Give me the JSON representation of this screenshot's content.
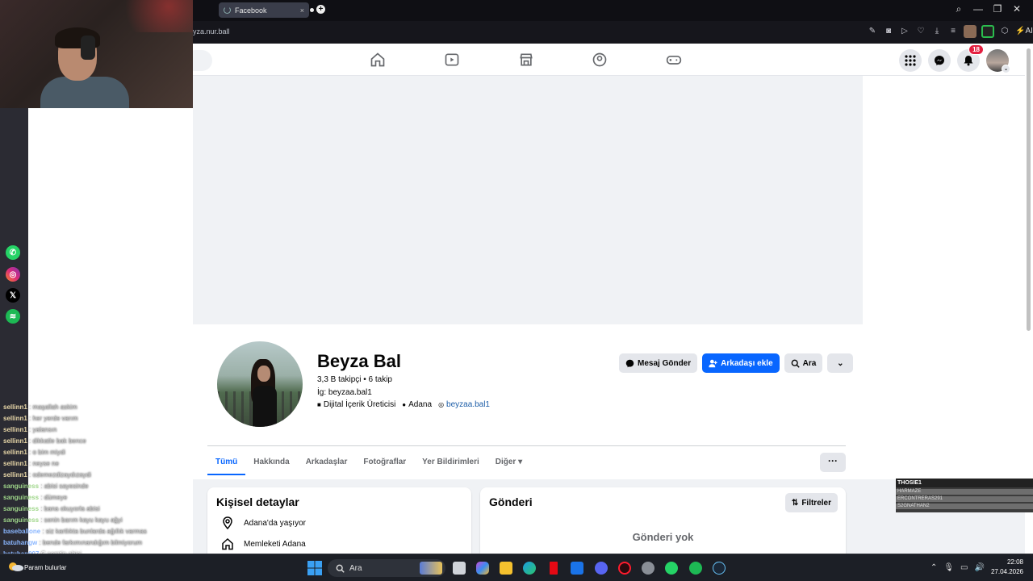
{
  "browser": {
    "tab_title": "Facebook",
    "tab_close": "×",
    "new_tab": "+",
    "address": "yza.nur.ball",
    "ai_label": "AI",
    "window_controls": [
      "⌕",
      "—",
      "❐",
      "✕"
    ]
  },
  "facebook": {
    "notification_count": "18",
    "profile": {
      "name": "Beyza Bal",
      "stats": "3,3 B takipçi • 6 takip",
      "instagram_line": "İg: beyzaa.bal1",
      "category": "Dijital İçerik Üreticisi",
      "location": "Adana",
      "link": "beyzaa.bal1"
    },
    "actions": {
      "message": "Mesaj Gönder",
      "add_friend": "Arkadaşı ekle",
      "search": "Ara"
    },
    "tabs": [
      "Tümü",
      "Hakkında",
      "Arkadaşlar",
      "Fotoğraflar",
      "Yer Bildirimleri",
      "Diğer"
    ],
    "details": {
      "title": "Kişisel detaylar",
      "lives": "Adana'da yaşıyor",
      "hometown": "Memleketi Adana"
    },
    "posts": {
      "title": "Gönderi",
      "filters": "Filtreler",
      "empty": "Gönderi yok"
    }
  },
  "chat": [
    {
      "user": "sellinn1",
      "msg": ": maşallah askim",
      "color": "u1"
    },
    {
      "user": "sellinn1",
      "msg": ": her yerde varım",
      "color": "u1"
    },
    {
      "user": "sellinn1",
      "msg": ": yalansın",
      "color": "u1"
    },
    {
      "user": "sellinn1",
      "msg": ": dikkatle bak bence",
      "color": "u1"
    },
    {
      "user": "sellinn1",
      "msg": ": o bim miydi",
      "color": "u1"
    },
    {
      "user": "sellinn1",
      "msg": ": neyse ne",
      "color": "u1"
    },
    {
      "user": "sellinn1",
      "msg": ": odemezdizaydızaydi",
      "color": "u1"
    },
    {
      "user": "sanguiness",
      "msg": ": abisi sayesinde",
      "color": "u2"
    },
    {
      "user": "sanguiness",
      "msg": ": dümeye",
      "color": "u2"
    },
    {
      "user": "sanguiness",
      "msg": ": bana okuyorla abisi",
      "color": "u2"
    },
    {
      "user": "sanguiness",
      "msg": ": senin barım kayu kayu ağyi",
      "color": "u2"
    },
    {
      "user": "baseballone",
      "msg": ": siz kartlıkta bunlarda ağıllık varmas",
      "color": "u3"
    },
    {
      "user": "batuhangw",
      "msg": ": bende farkımınandığım bilmiyorum",
      "color": "u3"
    },
    {
      "user": "batuhan007",
      "msg": "C semtin abisi",
      "color": "u3"
    },
    {
      "user": "sellinn1",
      "msg": ": aşk acısı mı çekiyodun askim",
      "color": "u1"
    }
  ],
  "chat_extra": "Param bulurlar",
  "ranking": {
    "header": "THOSIE1",
    "rows": [
      "HARMAZE",
      "ERCONTRERAS291",
      "S2GNATHAN2"
    ]
  },
  "taskbar": {
    "search_placeholder": "Ara",
    "time": "22:08",
    "date": "27.04.2026"
  },
  "colors": {
    "fb_blue": "#0866ff",
    "badge_red": "#e41e3f",
    "link_blue": "#1d5ea8"
  }
}
